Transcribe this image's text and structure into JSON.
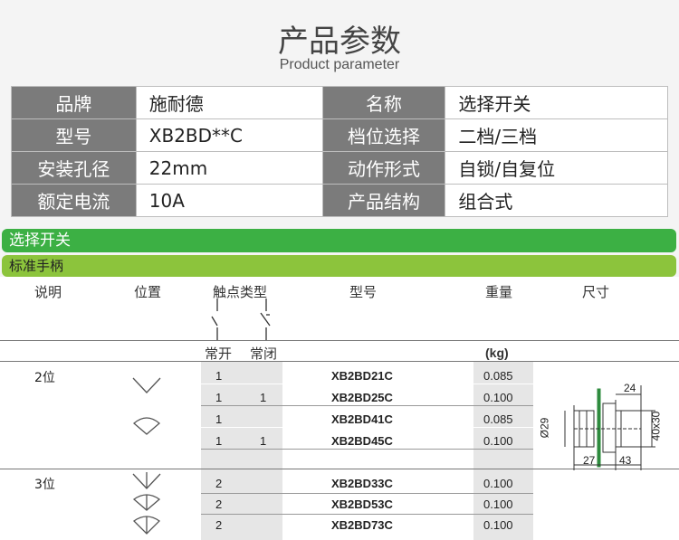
{
  "header": {
    "title": "产品参数",
    "subtitle": "Product parameter"
  },
  "spec": [
    {
      "k1": "品牌",
      "v1": "施耐德",
      "k2": "名称",
      "v2": "选择开关"
    },
    {
      "k1": "型号",
      "v1": "XB2BD**C",
      "k2": "档位选择",
      "v2": "二档/三档"
    },
    {
      "k1": "安装孔径",
      "v1": "22mm",
      "k2": "动作形式",
      "v2": "自锁/自复位"
    },
    {
      "k1": "额定电流",
      "v1": "10A",
      "k2": "产品结构",
      "v2": "组合式"
    }
  ],
  "bands": {
    "section": "选择开关",
    "handle": "标准手柄"
  },
  "columns": {
    "desc": "说明",
    "pos": "位置",
    "contact": "触点类型",
    "model": "型号",
    "weight": "重量",
    "size": "尺寸",
    "no": "常开",
    "nc": "常闭",
    "kg": "(kg)"
  },
  "groups": [
    {
      "label": "2位",
      "rows": [
        {
          "no": "1",
          "nc": "",
          "model": "XB2BD21C",
          "weight": "0.085"
        },
        {
          "no": "1",
          "nc": "1",
          "model": "XB2BD25C",
          "weight": "0.100"
        },
        {
          "no": "1",
          "nc": "",
          "model": "XB2BD41C",
          "weight": "0.085"
        },
        {
          "no": "1",
          "nc": "1",
          "model": "XB2BD45C",
          "weight": "0.100"
        }
      ]
    },
    {
      "label": "3位",
      "rows": [
        {
          "no": "2",
          "nc": "",
          "model": "XB2BD33C",
          "weight": "0.100"
        },
        {
          "no": "2",
          "nc": "",
          "model": "XB2BD53C",
          "weight": "0.100"
        },
        {
          "no": "2",
          "nc": "",
          "model": "XB2BD73C",
          "weight": "0.100"
        }
      ]
    }
  ],
  "dims": {
    "d1": "24",
    "d2": "Ø29",
    "d3": "40x30",
    "d4": "27",
    "d5": "43"
  }
}
